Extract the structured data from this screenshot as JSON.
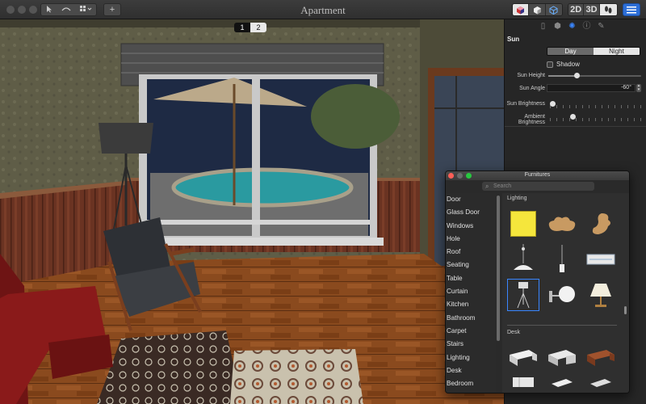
{
  "window": {
    "title": "Apartment"
  },
  "toolbar": {
    "add_label": "+",
    "view_2d": "2D",
    "view_3d": "3D"
  },
  "page_tabs": [
    "1",
    "2"
  ],
  "inspector": {
    "section_title": "Sun",
    "day_label": "Day",
    "night_label": "Night",
    "active_mode": "Night",
    "shadow_label": "Shadow",
    "shadow_checked": false,
    "sun_height_label": "Sun Height",
    "sun_height_value": 0.3,
    "sun_angle_label": "Sun Angle",
    "sun_angle_value": "-60°",
    "sun_brightness_label": "Sun Brightness",
    "sun_brightness_value": 0.0,
    "ambient_brightness_label": "Ambient Brightness",
    "ambient_brightness_value": 0.25
  },
  "furnitures": {
    "title": "Furnitures",
    "search_placeholder": "Search",
    "categories": [
      "Door",
      "Glass Door",
      "Windows",
      "Hole",
      "Roof",
      "Seating",
      "Table",
      "Curtain",
      "Kitchen",
      "Bathroom",
      "Carpet",
      "Stairs",
      "Lighting",
      "Desk",
      "Bedroom"
    ],
    "sections": [
      {
        "title": "Lighting"
      },
      {
        "title": "Desk"
      }
    ]
  },
  "colors": {
    "accent": "#3a86ff",
    "toolbar_bg": "#2f2f2f",
    "panel_bg": "#262626"
  }
}
